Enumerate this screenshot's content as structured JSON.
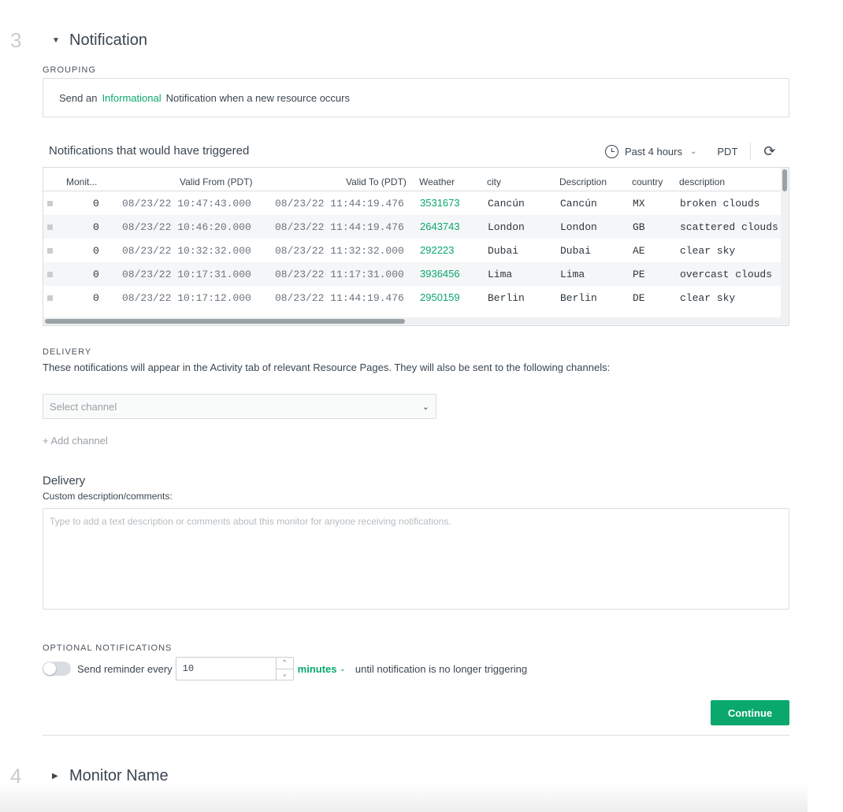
{
  "step3": {
    "number": "3",
    "title": "Notification",
    "caret": "▼"
  },
  "grouping": {
    "label": "GROUPING",
    "prefix": "Send an",
    "level": "Informational",
    "suffix": "Notification when a new resource occurs"
  },
  "preview": {
    "title": "Notifications that would have triggered",
    "time_range": "Past 4 hours",
    "timezone": "PDT",
    "columns": [
      "Monit...",
      "Valid From (PDT)",
      "Valid To (PDT)",
      "Weather",
      "city",
      "Description",
      "country",
      "description"
    ],
    "rows": [
      {
        "monitor": "0",
        "valid_from": "08/23/22 10:47:43.000",
        "valid_to": "08/23/22 11:44:19.476",
        "weather": "3531673",
        "city": "Cancún",
        "description": "Cancún",
        "country": "MX",
        "weather_desc": "broken clouds"
      },
      {
        "monitor": "0",
        "valid_from": "08/23/22 10:46:20.000",
        "valid_to": "08/23/22 11:44:19.476",
        "weather": "2643743",
        "city": "London",
        "description": "London",
        "country": "GB",
        "weather_desc": "scattered clouds"
      },
      {
        "monitor": "0",
        "valid_from": "08/23/22 10:32:32.000",
        "valid_to": "08/23/22 11:32:32.000",
        "weather": "292223",
        "city": "Dubai",
        "description": "Dubai",
        "country": "AE",
        "weather_desc": "clear sky"
      },
      {
        "monitor": "0",
        "valid_from": "08/23/22 10:17:31.000",
        "valid_to": "08/23/22 11:17:31.000",
        "weather": "3936456",
        "city": "Lima",
        "description": "Lima",
        "country": "PE",
        "weather_desc": "overcast clouds"
      },
      {
        "monitor": "0",
        "valid_from": "08/23/22 10:17:12.000",
        "valid_to": "08/23/22 11:44:19.476",
        "weather": "2950159",
        "city": "Berlin",
        "description": "Berlin",
        "country": "DE",
        "weather_desc": "clear sky"
      }
    ]
  },
  "delivery": {
    "label": "DELIVERY",
    "description": "These notifications will appear in the Activity tab of relevant Resource Pages. They will also be sent to the following channels:",
    "select_placeholder": "Select channel",
    "add_channel": "+ Add channel",
    "heading": "Delivery",
    "comments_label": "Custom description/comments:",
    "comments_placeholder": "Type to add a text description or comments about this monitor for anyone receiving notifications."
  },
  "optional": {
    "label": "OPTIONAL NOTIFICATIONS",
    "reminder_prefix": "Send reminder every",
    "interval_value": "10",
    "unit": "minutes",
    "reminder_suffix": "until notification is no longer triggering",
    "reminder_enabled": false
  },
  "continue_label": "Continue",
  "step4": {
    "number": "4",
    "title": "Monitor Name",
    "caret": "▶"
  },
  "colors": {
    "accent": "#0aa86c",
    "text": "#3b4650",
    "border": "#d9dde1"
  }
}
